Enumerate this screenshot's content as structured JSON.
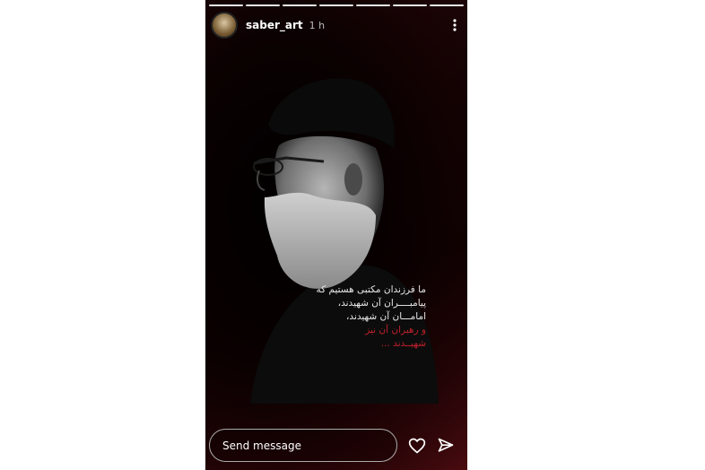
{
  "story": {
    "username": "saber_art",
    "time": "1 h",
    "progress_segments": 7,
    "quote_white": [
      "ما فرزندان مکتبی هستیم که",
      "پیامبــــران آن شهیدند،",
      "امامـــان آن شهیدند،"
    ],
    "quote_red": [
      "و رهبران آن نیز",
      "شهیــدند ..."
    ],
    "message_placeholder": "Send message"
  },
  "icons": {
    "more": "more-vertical-icon",
    "like": "heart-icon",
    "share": "send-icon"
  },
  "colors": {
    "accent_red": "#c0202a",
    "text_white": "#e8e8e8"
  }
}
